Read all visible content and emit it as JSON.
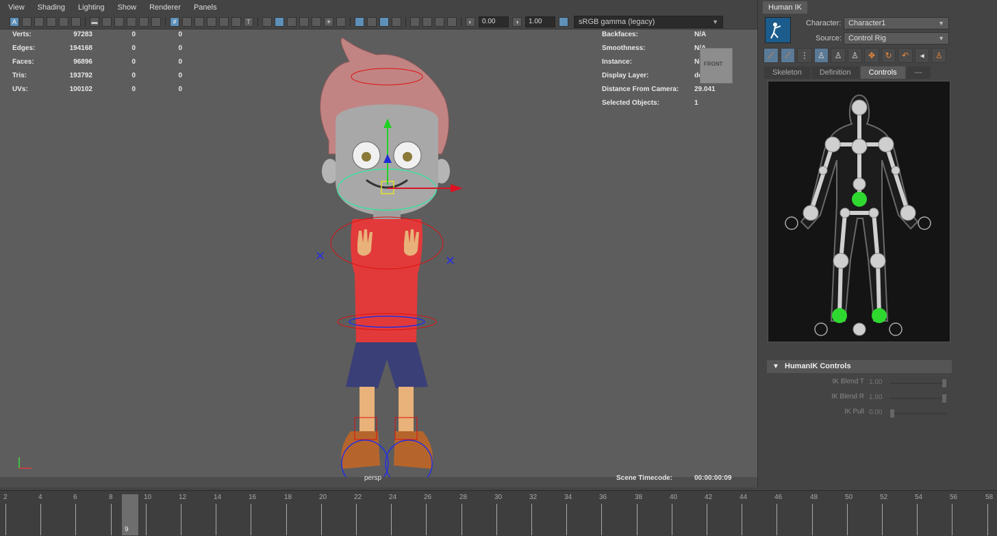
{
  "menu": [
    "View",
    "Shading",
    "Lighting",
    "Show",
    "Renderer",
    "Panels"
  ],
  "toolbar": {
    "exposure": "0.00",
    "gamma": "1.00",
    "color_space": "sRGB gamma (legacy)"
  },
  "hud_left": [
    {
      "label": "Verts:",
      "v1": "97283",
      "v2": "0",
      "v3": "0"
    },
    {
      "label": "Edges:",
      "v1": "194168",
      "v2": "0",
      "v3": "0"
    },
    {
      "label": "Faces:",
      "v1": "96896",
      "v2": "0",
      "v3": "0"
    },
    {
      "label": "Tris:",
      "v1": "193792",
      "v2": "0",
      "v3": "0"
    },
    {
      "label": "UVs:",
      "v1": "100102",
      "v2": "0",
      "v3": "0"
    }
  ],
  "hud_right": [
    {
      "label": "Backfaces:",
      "value": "N/A"
    },
    {
      "label": "Smoothness:",
      "value": "N/A"
    },
    {
      "label": "Instance:",
      "value": "No"
    },
    {
      "label": "Display Layer:",
      "value": "default"
    },
    {
      "label": "Distance From Camera:",
      "value": "29.041"
    },
    {
      "label": "Selected Objects:",
      "value": "1"
    }
  ],
  "viewcube_label": "FRONT",
  "camera_name": "persp",
  "timecode": {
    "label": "Scene Timecode:",
    "value": "00:00:00:09"
  },
  "humanik": {
    "tab": "Human IK",
    "character_label": "Character:",
    "character_value": "Character1",
    "source_label": "Source:",
    "source_value": "Control Rig",
    "subtabs": [
      "Skeleton",
      "Definition",
      "Controls",
      "---"
    ],
    "selected_subtab": "Controls",
    "controls_header": "HumanIK Controls",
    "sliders": [
      {
        "label": "IK Blend T",
        "value": "1.00",
        "level": 1.0
      },
      {
        "label": "IK Blend R",
        "value": "1.00",
        "level": 1.0
      },
      {
        "label": "IK Pull",
        "value": "0.00",
        "level": 0.0
      }
    ]
  },
  "timeline": {
    "labels": [
      "2",
      "4",
      "6",
      "8",
      "10",
      "12",
      "14",
      "16",
      "18",
      "20",
      "22",
      "24",
      "26",
      "28",
      "30",
      "32",
      "34",
      "36",
      "38",
      "40",
      "42",
      "44",
      "46",
      "48",
      "50",
      "52",
      "54",
      "56",
      "58"
    ],
    "current_frame": "9"
  },
  "colors": {
    "accent": "#5e90b8",
    "shirt": "#e23a3a",
    "shorts": "#3a3f78",
    "hair": "#c28383",
    "ik_green": "#2fd82f"
  }
}
